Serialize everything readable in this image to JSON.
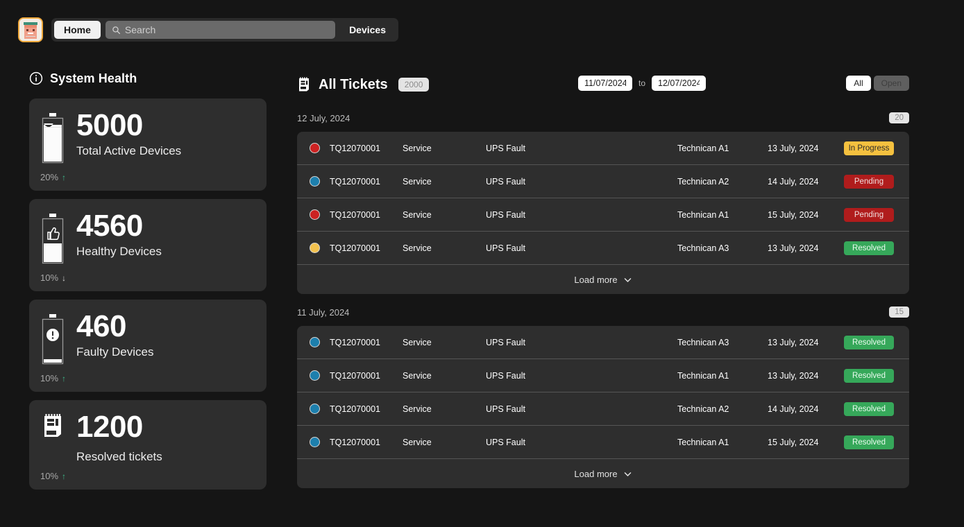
{
  "topbar": {
    "avatar_name": "user-avatar",
    "home_label": "Home",
    "search_placeholder": "Search",
    "search_value": "",
    "devices_label": "Devices"
  },
  "system_health": {
    "title": "System Health",
    "info_icon": "info-circle-icon",
    "cards": [
      {
        "icon": "battery-full-icon",
        "value": "5000",
        "label": "Total Active Devices",
        "delta": "20%",
        "direction": "up"
      },
      {
        "icon": "battery-thumbs-up-icon",
        "value": "4560",
        "label": "Healthy Devices",
        "delta": "10%",
        "direction": "down"
      },
      {
        "icon": "battery-alert-icon",
        "value": "460",
        "label": "Faulty Devices",
        "delta": "10%",
        "direction": "up"
      },
      {
        "icon": "receipt-icon",
        "value": "1200",
        "label": "Resolved tickets",
        "delta": "10%",
        "direction": "up"
      }
    ]
  },
  "tickets": {
    "icon": "receipt-icon",
    "title": "All Tickets",
    "count": "2000",
    "date_from": "11/07/2024",
    "date_to": "12/07/2024",
    "date_separator": "to",
    "filters": [
      {
        "label": "All",
        "selected": true
      },
      {
        "label": "Open",
        "selected": false
      }
    ],
    "load_more_label": "Load more",
    "colors": {
      "in_progress_bg": "#f5c13f",
      "in_progress_fg": "#2b2b2b",
      "pending_bg": "#b01c1c",
      "pending_fg": "#f0dede",
      "resolved_bg": "#36a85a",
      "resolved_fg": "#eafbef",
      "dot_red": "#cc2222",
      "dot_blue": "#1d7fad",
      "dot_amber": "#f2c14e"
    },
    "groups": [
      {
        "date": "12 July, 2024",
        "badge": "20",
        "rows": [
          {
            "dot": "red",
            "id": "TQ12070001",
            "type": "Service",
            "fault": "UPS Fault",
            "technician": "Technican A1",
            "date": "13 July, 2024",
            "status": "In Progress"
          },
          {
            "dot": "blue",
            "id": "TQ12070001",
            "type": "Service",
            "fault": "UPS Fault",
            "technician": "Technican A2",
            "date": "14 July, 2024",
            "status": "Pending"
          },
          {
            "dot": "red",
            "id": "TQ12070001",
            "type": "Service",
            "fault": "UPS Fault",
            "technician": "Technican A1",
            "date": "15 July, 2024",
            "status": "Pending"
          },
          {
            "dot": "amber",
            "id": "TQ12070001",
            "type": "Service",
            "fault": "UPS Fault",
            "technician": "Technican A3",
            "date": "13 July, 2024",
            "status": "Resolved"
          }
        ]
      },
      {
        "date": "11 July, 2024",
        "badge": "15",
        "rows": [
          {
            "dot": "blue",
            "id": "TQ12070001",
            "type": "Service",
            "fault": "UPS Fault",
            "technician": "Technican A3",
            "date": "13 July, 2024",
            "status": "Resolved"
          },
          {
            "dot": "blue",
            "id": "TQ12070001",
            "type": "Service",
            "fault": "UPS Fault",
            "technician": "Technican A1",
            "date": "13 July, 2024",
            "status": "Resolved"
          },
          {
            "dot": "blue",
            "id": "TQ12070001",
            "type": "Service",
            "fault": "UPS Fault",
            "technician": "Technican A2",
            "date": "14 July, 2024",
            "status": "Resolved"
          },
          {
            "dot": "blue",
            "id": "TQ12070001",
            "type": "Service",
            "fault": "UPS Fault",
            "technician": "Technican A1",
            "date": "15 July, 2024",
            "status": "Resolved"
          }
        ]
      }
    ]
  }
}
